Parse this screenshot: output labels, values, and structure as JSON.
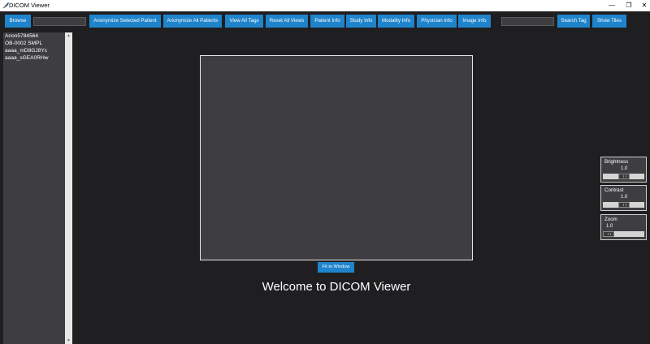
{
  "window": {
    "title": "DICOM Viewer",
    "controls": {
      "minimize": "—",
      "maximize": "❐",
      "close": "✕"
    }
  },
  "toolbar": {
    "browse": "Browse",
    "path_value": "",
    "anonymize_selected": "Anonymize Selected Patient",
    "anonymize_all": "Anonymize All Patients",
    "view_all_tags": "View All Tags",
    "reset_all_views": "Reset All Views",
    "patient_info": "Patient Info",
    "study_info": "Study Info",
    "modality_info": "Modality Info",
    "physician_info": "Physician Info",
    "image_info": "Image Info",
    "search_value": "",
    "search_tag": "Search Tag",
    "show_tiles": "Show Tiles"
  },
  "patients": [
    "Anon5784564",
    "OB-0002 SMPL",
    "aaaa_mD8GJ8Yc",
    "aaaa_sGEA0RHw"
  ],
  "scrollbar": {
    "up": "▲",
    "down": "▼"
  },
  "viewer": {
    "fit_to_window": "Fit to Window",
    "welcome": "Welcome to DICOM Viewer"
  },
  "sliders": {
    "brightness": {
      "label": "Brightness",
      "value": "1.0",
      "level": 0.5
    },
    "contrast": {
      "label": "Contrast",
      "value": "1.0",
      "level": 0.5
    },
    "zoom": {
      "label": "Zoom",
      "value": "1.0",
      "level": 0.0
    }
  },
  "colors": {
    "background": "#1f1e21",
    "panel": "#3e3d40",
    "accent_button": "#1f84cb"
  }
}
